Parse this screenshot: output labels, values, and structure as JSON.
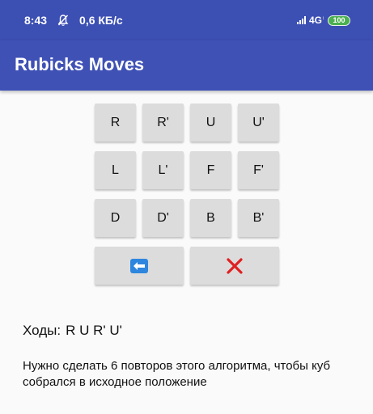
{
  "status_bar": {
    "time": "8:43",
    "net_speed": "0,6 КБ/с",
    "network_type": "4G",
    "battery": "100",
    "mute_icon": "bell-off-icon",
    "signal_icon": "signal-icon"
  },
  "app_bar": {
    "title": "Rubicks Moves",
    "color": "#3f51b5"
  },
  "moves_pad": {
    "buttons": [
      "R",
      "R'",
      "U",
      "U'",
      "L",
      "L'",
      "F",
      "F'",
      "D",
      "D'",
      "B",
      "B'"
    ],
    "backspace_icon": "left-arrow-icon",
    "clear_icon": "red-x-icon"
  },
  "result": {
    "moves_label": "Ходы:",
    "moves_value": "R U R' U'",
    "hint": "Нужно сделать 6 повторов этого алгоритма, чтобы куб собрался в исходное положение"
  }
}
